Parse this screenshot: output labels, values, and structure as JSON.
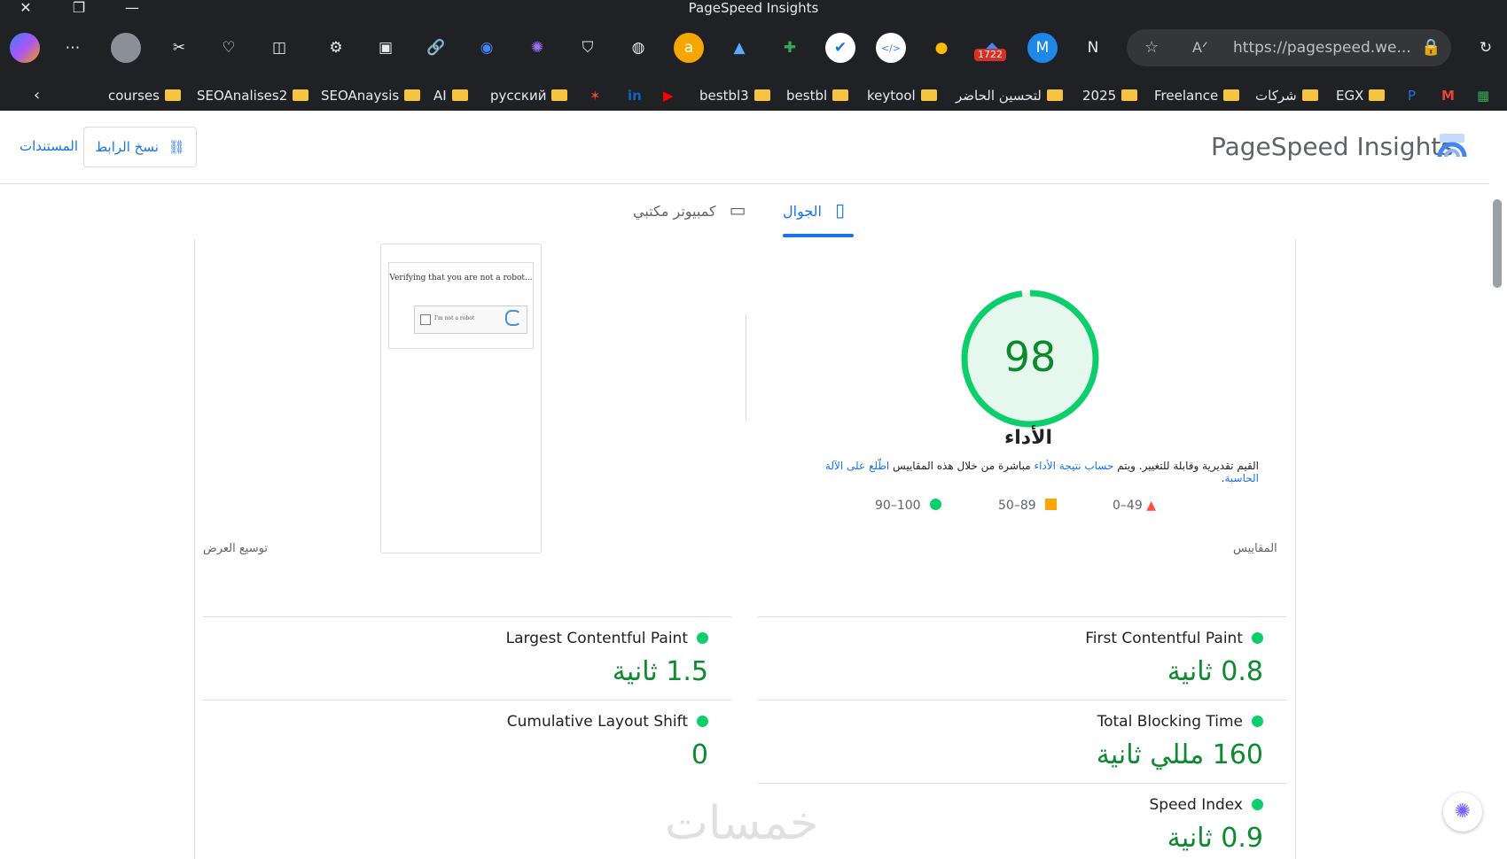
{
  "window": {
    "title": "PageSpeed Insights",
    "close": "✕",
    "restore": "❐",
    "minimize": "—"
  },
  "toolbar": {
    "url": "https://pagespeed.we...",
    "badge_count": "1722",
    "extensions": [
      "copilot-icon",
      "more-icon",
      "profile-avatar",
      "puzzle-icon",
      "heart-icon",
      "split-icon",
      "extension-icon",
      "pin-icon",
      "link-icon",
      "chat-icon",
      "brain-icon",
      "shield-icon",
      "globe-icon",
      "amazon-icon",
      "chart-icon",
      "spark-icon",
      "check-icon",
      "code-icon",
      "orange-icon",
      "counter-icon",
      "m-icon",
      "notion-icon"
    ]
  },
  "bookmarks": [
    "courses",
    "SEOAnalises2",
    "SEOAnaysis",
    "AI",
    "русский",
    "bestbl3",
    "bestbl",
    "keytool",
    "لتحسين الحاضر",
    "2025",
    "Freelance",
    "شركات",
    "EGX"
  ],
  "header": {
    "logo_text": "PageSpeed Insights",
    "copy_link": "نسخ الرابط",
    "docs": "المستندات"
  },
  "tabs": {
    "mobile": "الجوال",
    "desktop": "كمبيوتر مكتبي"
  },
  "performance": {
    "score": "98",
    "title": "الأداء",
    "desc_prefix": "القيم تقديرية وقابلة للتغيير. ويتم ",
    "desc_link1": "حساب نتيجة الأداء",
    "desc_mid": " مباشرة من خلال هذه المقاييس ",
    "desc_link2": "اطّلع على الآلة الحاسبة",
    "desc_suffix": ".",
    "legend": {
      "fail": "0–49",
      "average": "50–89",
      "pass": "90–100"
    }
  },
  "screenshot": {
    "text": "Verifying that you are not a robot...",
    "captcha_label": "I'm not a robot"
  },
  "sections": {
    "metrics": "المقاييس",
    "expand": "توسيع العرض"
  },
  "metrics": [
    {
      "name": "First Contentful Paint",
      "value": "0.8 ثانية"
    },
    {
      "name": "Largest Contentful Paint",
      "value": "1.5 ثانية"
    },
    {
      "name": "Total Blocking Time",
      "value": "160 مللي ثانية"
    },
    {
      "name": "Cumulative Layout Shift",
      "value": "0"
    },
    {
      "name": "Speed Index",
      "value": "0.9 ثانية"
    }
  ],
  "watermark": "خمسات",
  "colors": {
    "pass": "#0cce6b",
    "average": "#ffa400",
    "fail": "#ff4e42",
    "accent": "#1a73e8"
  }
}
